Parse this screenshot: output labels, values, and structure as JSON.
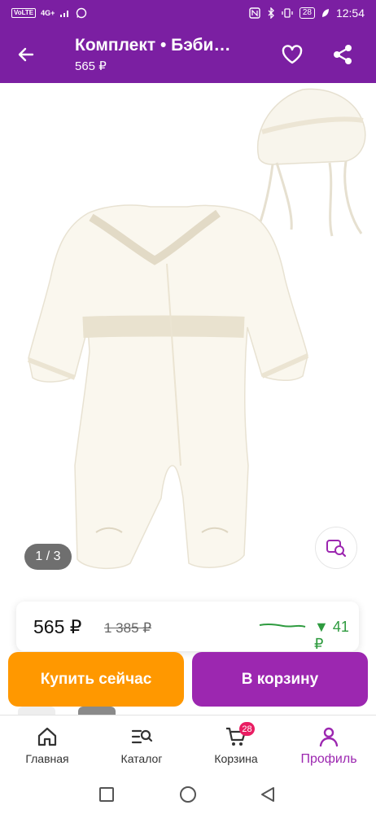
{
  "status_bar": {
    "network_badge_1": "VoLTE",
    "network_badge_2": "4G+",
    "battery": "28",
    "time": "12:54"
  },
  "header": {
    "title": "Комплект • Бэби…",
    "price": "565 ₽",
    "icons": {
      "back": "arrow-left",
      "favorite": "heart-outline",
      "share": "share-nodes"
    }
  },
  "gallery": {
    "counter": "1 / 3",
    "visual_search_icon": "image-search"
  },
  "price_card": {
    "current": "565 ₽",
    "old": "1 385 ₽",
    "drop": "▼ 41 ₽",
    "drop_color": "#2e9b3f"
  },
  "actions": {
    "buy_now": "Купить сейчас",
    "add_to_cart": "В корзину",
    "buy_color": "#ff9800",
    "cart_color": "#9c27b0"
  },
  "bottom_nav": {
    "items": [
      {
        "label": "Главная",
        "icon": "home"
      },
      {
        "label": "Каталог",
        "icon": "catalog-search"
      },
      {
        "label": "Корзина",
        "icon": "cart",
        "badge": "28"
      },
      {
        "label": "Профиль",
        "icon": "profile",
        "active": true
      }
    ]
  },
  "theme": {
    "primary": "#7b1fa2",
    "accent": "#9c27b0"
  }
}
